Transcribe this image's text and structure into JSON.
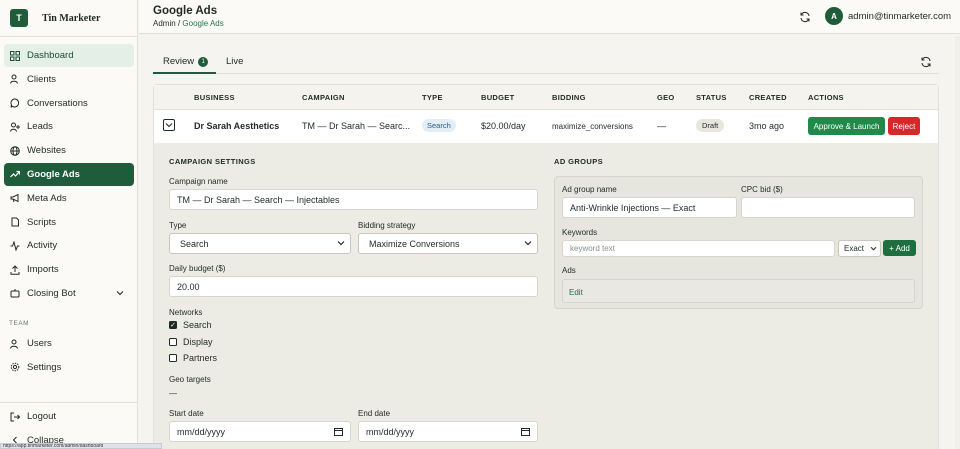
{
  "brand": {
    "logo_letter": "T",
    "name": "Tin Marketer"
  },
  "sidebar": {
    "items": [
      {
        "label": "Dashboard",
        "icon": "dashboard-icon"
      },
      {
        "label": "Clients",
        "icon": "users-icon"
      },
      {
        "label": "Conversations",
        "icon": "chat-icon"
      },
      {
        "label": "Leads",
        "icon": "user-plus-icon"
      },
      {
        "label": "Websites",
        "icon": "globe-icon"
      },
      {
        "label": "Google Ads",
        "icon": "trend-icon"
      },
      {
        "label": "Meta Ads",
        "icon": "megaphone-icon"
      },
      {
        "label": "Scripts",
        "icon": "code-icon"
      },
      {
        "label": "Activity",
        "icon": "activity-icon"
      },
      {
        "label": "Imports",
        "icon": "upload-icon"
      },
      {
        "label": "Closing Bot",
        "icon": "bot-icon"
      }
    ],
    "team_label": "TEAM",
    "team_items": [
      {
        "label": "Users",
        "icon": "users-icon"
      },
      {
        "label": "Settings",
        "icon": "gear-icon"
      }
    ],
    "logout": "Logout",
    "collapse": "Collapse"
  },
  "header": {
    "title": "Google Ads",
    "crumb_root": "Admin",
    "crumb_sep": "/",
    "crumb_current": "Google Ads",
    "avatar_letter": "A",
    "user_email": "admin@tinmarketer.com"
  },
  "tabs": {
    "review": "Review",
    "review_count": "1",
    "live": "Live"
  },
  "table": {
    "headers": [
      "BUSINESS",
      "CAMPAIGN",
      "TYPE",
      "BUDGET",
      "BIDDING",
      "GEO",
      "STATUS",
      "CREATED",
      "ACTIONS"
    ],
    "row": {
      "business": "Dr Sarah Aesthetics",
      "campaign": "TM — Dr Sarah — Searc...",
      "type": "Search",
      "budget": "$20.00/day",
      "bidding": "maximize_conversions",
      "geo": "—",
      "status": "Draft",
      "created": "3mo ago",
      "approve": "Approve & Launch",
      "reject": "Reject"
    }
  },
  "settings": {
    "title": "CAMPAIGN SETTINGS",
    "campaign_name_label": "Campaign name",
    "campaign_name": "TM — Dr Sarah — Search — Injectables",
    "type_label": "Type",
    "type_value": "Search",
    "bidding_label": "Bidding strategy",
    "bidding_value": "Maximize Conversions",
    "budget_label": "Daily budget ($)",
    "budget_value": "20.00",
    "networks_label": "Networks",
    "networks": [
      {
        "label": "Search",
        "checked": true
      },
      {
        "label": "Display",
        "checked": false
      },
      {
        "label": "Partners",
        "checked": false
      }
    ],
    "geo_label": "Geo targets",
    "geo_value": "—",
    "start_label": "Start date",
    "start_value": "mm/dd/yyyy",
    "end_label": "End date",
    "end_value": "mm/dd/yyyy"
  },
  "adgroups": {
    "title": "AD GROUPS",
    "name_label": "Ad group name",
    "name_value": "Anti-Wrinkle Injections — Exact",
    "cpc_label": "CPC bid ($)",
    "cpc_value": "",
    "keywords_label": "Keywords",
    "keyword_placeholder": "keyword text",
    "match_type": "Exact",
    "add_label": "+ Add",
    "ads_label": "Ads",
    "edit_label": "Edit"
  },
  "statusbar": {
    "url": "https://app.tinmarketer.com/admin/dashboard"
  }
}
